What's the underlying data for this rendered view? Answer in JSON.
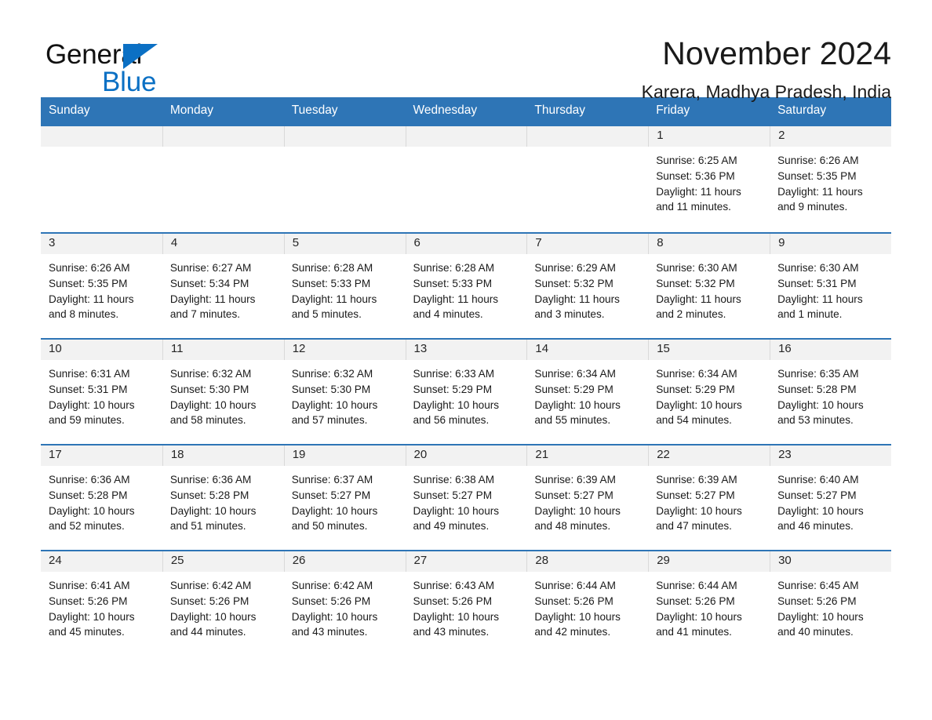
{
  "brand": {
    "name_part1": "General",
    "name_part2": "Blue",
    "accent_color": "#0b70c4"
  },
  "header": {
    "title": "November 2024",
    "subtitle": "Karera, Madhya Pradesh, India",
    "header_bg_color": "#2e75b6",
    "daynum_band_color": "#f2f2f2"
  },
  "weekday_headers": [
    "Sunday",
    "Monday",
    "Tuesday",
    "Wednesday",
    "Thursday",
    "Friday",
    "Saturday"
  ],
  "weeks": [
    [
      {
        "day": "",
        "sunrise": "",
        "sunset": "",
        "daylight": "",
        "empty": true
      },
      {
        "day": "",
        "sunrise": "",
        "sunset": "",
        "daylight": "",
        "empty": true
      },
      {
        "day": "",
        "sunrise": "",
        "sunset": "",
        "daylight": "",
        "empty": true
      },
      {
        "day": "",
        "sunrise": "",
        "sunset": "",
        "daylight": "",
        "empty": true
      },
      {
        "day": "",
        "sunrise": "",
        "sunset": "",
        "daylight": "",
        "empty": true
      },
      {
        "day": "1",
        "sunrise": "Sunrise: 6:25 AM",
        "sunset": "Sunset: 5:36 PM",
        "daylight": "Daylight: 11 hours and 11 minutes.",
        "empty": false
      },
      {
        "day": "2",
        "sunrise": "Sunrise: 6:26 AM",
        "sunset": "Sunset: 5:35 PM",
        "daylight": "Daylight: 11 hours and 9 minutes.",
        "empty": false
      }
    ],
    [
      {
        "day": "3",
        "sunrise": "Sunrise: 6:26 AM",
        "sunset": "Sunset: 5:35 PM",
        "daylight": "Daylight: 11 hours and 8 minutes.",
        "empty": false
      },
      {
        "day": "4",
        "sunrise": "Sunrise: 6:27 AM",
        "sunset": "Sunset: 5:34 PM",
        "daylight": "Daylight: 11 hours and 7 minutes.",
        "empty": false
      },
      {
        "day": "5",
        "sunrise": "Sunrise: 6:28 AM",
        "sunset": "Sunset: 5:33 PM",
        "daylight": "Daylight: 11 hours and 5 minutes.",
        "empty": false
      },
      {
        "day": "6",
        "sunrise": "Sunrise: 6:28 AM",
        "sunset": "Sunset: 5:33 PM",
        "daylight": "Daylight: 11 hours and 4 minutes.",
        "empty": false
      },
      {
        "day": "7",
        "sunrise": "Sunrise: 6:29 AM",
        "sunset": "Sunset: 5:32 PM",
        "daylight": "Daylight: 11 hours and 3 minutes.",
        "empty": false
      },
      {
        "day": "8",
        "sunrise": "Sunrise: 6:30 AM",
        "sunset": "Sunset: 5:32 PM",
        "daylight": "Daylight: 11 hours and 2 minutes.",
        "empty": false
      },
      {
        "day": "9",
        "sunrise": "Sunrise: 6:30 AM",
        "sunset": "Sunset: 5:31 PM",
        "daylight": "Daylight: 11 hours and 1 minute.",
        "empty": false
      }
    ],
    [
      {
        "day": "10",
        "sunrise": "Sunrise: 6:31 AM",
        "sunset": "Sunset: 5:31 PM",
        "daylight": "Daylight: 10 hours and 59 minutes.",
        "empty": false
      },
      {
        "day": "11",
        "sunrise": "Sunrise: 6:32 AM",
        "sunset": "Sunset: 5:30 PM",
        "daylight": "Daylight: 10 hours and 58 minutes.",
        "empty": false
      },
      {
        "day": "12",
        "sunrise": "Sunrise: 6:32 AM",
        "sunset": "Sunset: 5:30 PM",
        "daylight": "Daylight: 10 hours and 57 minutes.",
        "empty": false
      },
      {
        "day": "13",
        "sunrise": "Sunrise: 6:33 AM",
        "sunset": "Sunset: 5:29 PM",
        "daylight": "Daylight: 10 hours and 56 minutes.",
        "empty": false
      },
      {
        "day": "14",
        "sunrise": "Sunrise: 6:34 AM",
        "sunset": "Sunset: 5:29 PM",
        "daylight": "Daylight: 10 hours and 55 minutes.",
        "empty": false
      },
      {
        "day": "15",
        "sunrise": "Sunrise: 6:34 AM",
        "sunset": "Sunset: 5:29 PM",
        "daylight": "Daylight: 10 hours and 54 minutes.",
        "empty": false
      },
      {
        "day": "16",
        "sunrise": "Sunrise: 6:35 AM",
        "sunset": "Sunset: 5:28 PM",
        "daylight": "Daylight: 10 hours and 53 minutes.",
        "empty": false
      }
    ],
    [
      {
        "day": "17",
        "sunrise": "Sunrise: 6:36 AM",
        "sunset": "Sunset: 5:28 PM",
        "daylight": "Daylight: 10 hours and 52 minutes.",
        "empty": false
      },
      {
        "day": "18",
        "sunrise": "Sunrise: 6:36 AM",
        "sunset": "Sunset: 5:28 PM",
        "daylight": "Daylight: 10 hours and 51 minutes.",
        "empty": false
      },
      {
        "day": "19",
        "sunrise": "Sunrise: 6:37 AM",
        "sunset": "Sunset: 5:27 PM",
        "daylight": "Daylight: 10 hours and 50 minutes.",
        "empty": false
      },
      {
        "day": "20",
        "sunrise": "Sunrise: 6:38 AM",
        "sunset": "Sunset: 5:27 PM",
        "daylight": "Daylight: 10 hours and 49 minutes.",
        "empty": false
      },
      {
        "day": "21",
        "sunrise": "Sunrise: 6:39 AM",
        "sunset": "Sunset: 5:27 PM",
        "daylight": "Daylight: 10 hours and 48 minutes.",
        "empty": false
      },
      {
        "day": "22",
        "sunrise": "Sunrise: 6:39 AM",
        "sunset": "Sunset: 5:27 PM",
        "daylight": "Daylight: 10 hours and 47 minutes.",
        "empty": false
      },
      {
        "day": "23",
        "sunrise": "Sunrise: 6:40 AM",
        "sunset": "Sunset: 5:27 PM",
        "daylight": "Daylight: 10 hours and 46 minutes.",
        "empty": false
      }
    ],
    [
      {
        "day": "24",
        "sunrise": "Sunrise: 6:41 AM",
        "sunset": "Sunset: 5:26 PM",
        "daylight": "Daylight: 10 hours and 45 minutes.",
        "empty": false
      },
      {
        "day": "25",
        "sunrise": "Sunrise: 6:42 AM",
        "sunset": "Sunset: 5:26 PM",
        "daylight": "Daylight: 10 hours and 44 minutes.",
        "empty": false
      },
      {
        "day": "26",
        "sunrise": "Sunrise: 6:42 AM",
        "sunset": "Sunset: 5:26 PM",
        "daylight": "Daylight: 10 hours and 43 minutes.",
        "empty": false
      },
      {
        "day": "27",
        "sunrise": "Sunrise: 6:43 AM",
        "sunset": "Sunset: 5:26 PM",
        "daylight": "Daylight: 10 hours and 43 minutes.",
        "empty": false
      },
      {
        "day": "28",
        "sunrise": "Sunrise: 6:44 AM",
        "sunset": "Sunset: 5:26 PM",
        "daylight": "Daylight: 10 hours and 42 minutes.",
        "empty": false
      },
      {
        "day": "29",
        "sunrise": "Sunrise: 6:44 AM",
        "sunset": "Sunset: 5:26 PM",
        "daylight": "Daylight: 10 hours and 41 minutes.",
        "empty": false
      },
      {
        "day": "30",
        "sunrise": "Sunrise: 6:45 AM",
        "sunset": "Sunset: 5:26 PM",
        "daylight": "Daylight: 10 hours and 40 minutes.",
        "empty": false
      }
    ]
  ]
}
